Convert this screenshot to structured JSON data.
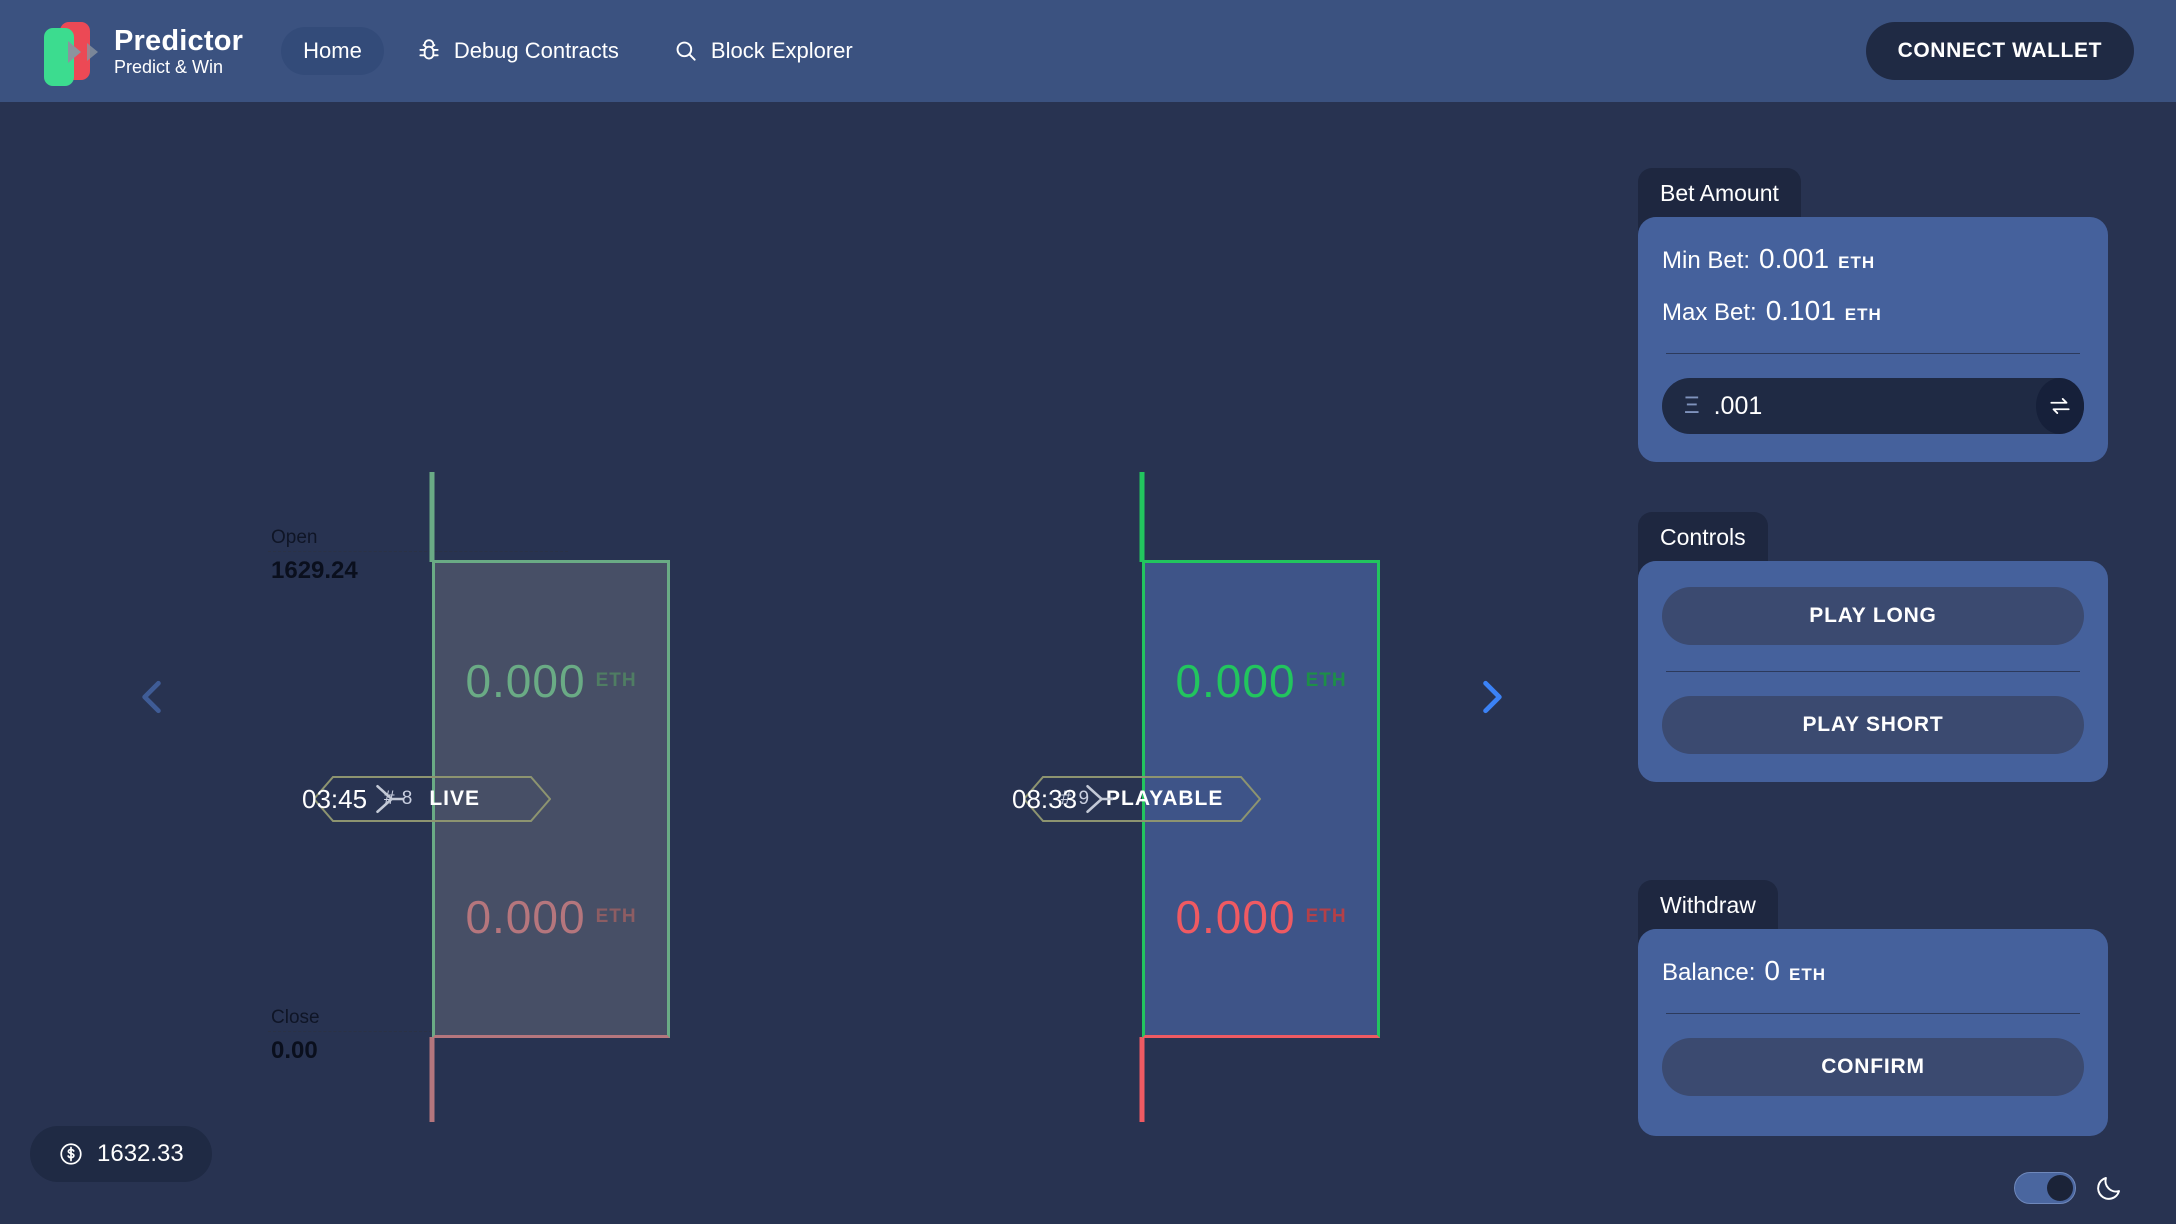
{
  "header": {
    "brand_title": "Predictor",
    "brand_subtitle": "Predict & Win",
    "nav": [
      {
        "label": "Home",
        "icon": "",
        "active": true
      },
      {
        "label": "Debug Contracts",
        "icon": "bug-icon",
        "active": false
      },
      {
        "label": "Block Explorer",
        "icon": "search-icon",
        "active": false
      }
    ],
    "connect_label": "CONNECT WALLET"
  },
  "chart": {
    "open_label": "Open",
    "open_value": "1629.24",
    "close_label": "Close",
    "close_value": "0.00",
    "price_badge": "1632.33",
    "price_icon": "dollar-circle-icon",
    "prev_icon": "chevron-left-icon",
    "next_icon": "chevron-right-icon",
    "candles": [
      {
        "timer": "03:45",
        "round_number": "# 8",
        "state": "LIVE",
        "long_amount": "0.000",
        "long_unit": "ETH",
        "short_amount": "0.000",
        "short_unit": "ETH",
        "up_color": "#6aab85",
        "down_color": "#b5767d",
        "fill_color": "#474f66",
        "active": false
      },
      {
        "timer": "08:33",
        "round_number": "# 9",
        "state": "PLAYABLE",
        "long_amount": "0.000",
        "long_unit": "ETH",
        "short_amount": "0.000",
        "short_unit": "ETH",
        "up_color": "#22c55e",
        "down_color": "#ef5a62",
        "fill_color": "#3e5488",
        "active": true
      }
    ]
  },
  "bet_amount": {
    "tab_label": "Bet Amount",
    "min_label": "Min Bet:",
    "min_value": "0.001",
    "min_unit": "ETH",
    "max_label": "Max Bet:",
    "max_value": "0.101",
    "max_unit": "ETH",
    "eth_glyph": "Ξ",
    "input_value": ".001",
    "input_placeholder": "0.001",
    "swap_icon": "swap-arrows-icon"
  },
  "controls": {
    "tab_label": "Controls",
    "play_long_label": "PLAY LONG",
    "play_short_label": "PLAY SHORT"
  },
  "withdraw": {
    "tab_label": "Withdraw",
    "balance_label": "Balance:",
    "balance_value": "0",
    "balance_unit": "ETH",
    "confirm_label": "CONFIRM",
    "theme_icon": "moon-icon",
    "theme_toggle_on": true
  },
  "colors": {
    "background": "#283351",
    "header": "#3b5280",
    "panel": "#45619c",
    "tab": "#1e2740",
    "accent_blue": "#3b82f6",
    "muted_blue": "#3a5488",
    "dark_pill": "#1f2a44",
    "hex_border": "#8d9470"
  }
}
